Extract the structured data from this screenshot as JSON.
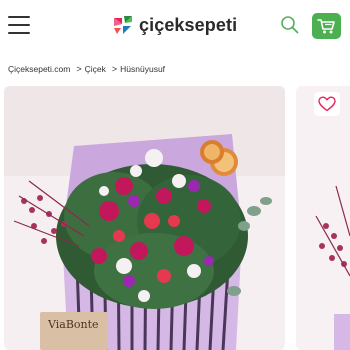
{
  "header": {
    "menu_icon": "hamburger-icon",
    "logo_text": "çiçeksepeti",
    "search_icon": "search-icon",
    "cart_icon": "cart-icon",
    "accent_color": "#4caf50"
  },
  "breadcrumb": {
    "items": [
      "Çiçeksepeti.com",
      "Çiçek",
      "Hüsnüyusuf"
    ],
    "separator": ">"
  },
  "product": {
    "favorite_icon": "heart-icon",
    "brand_tag": "ViaBonte"
  },
  "colors": {
    "brand_green": "#4caf50",
    "logo_pink": "#e8235c",
    "logo_green": "#2a8a3e",
    "logo_blue": "#1e7bc4",
    "heart_pink": "#e8235c"
  }
}
